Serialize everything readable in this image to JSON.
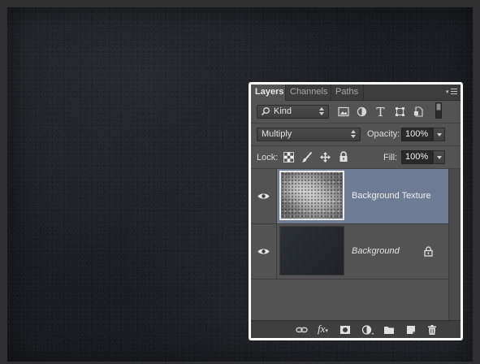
{
  "panel": {
    "tabs": [
      {
        "label": "Layers",
        "active": true
      },
      {
        "label": "Channels",
        "active": false
      },
      {
        "label": "Paths",
        "active": false
      }
    ],
    "filter": {
      "value": "Kind"
    },
    "blend_mode": {
      "value": "Multiply"
    },
    "opacity": {
      "label": "Opacity:",
      "value": "100%"
    },
    "lock": {
      "label": "Lock:"
    },
    "fill": {
      "label": "Fill:",
      "value": "100%"
    },
    "layers": [
      {
        "name": "Background Texture",
        "selected": true,
        "visible": true,
        "locked": false
      },
      {
        "name": "Background",
        "selected": false,
        "visible": true,
        "locked": true
      }
    ],
    "bottom_bar": {
      "fx_label": "fx"
    }
  },
  "colors": {
    "selection": "#6d7c94",
    "panel_bg": "#535353",
    "canvas_bg": "#1e2226",
    "highlight_border": "#ffffff"
  }
}
